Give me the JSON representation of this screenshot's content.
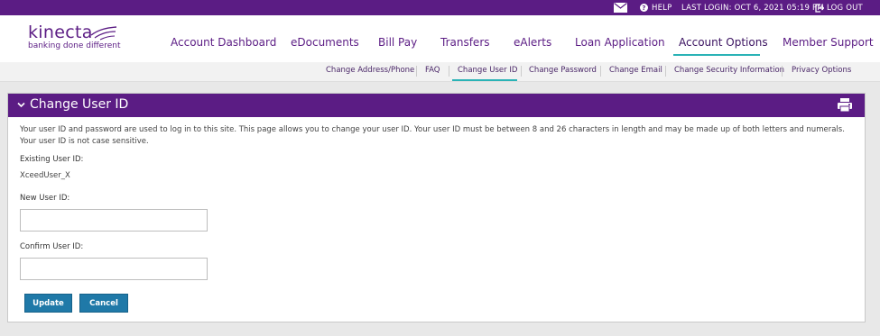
{
  "topbar": {
    "help_label": "HELP",
    "last_login": "LAST LOGIN: OCT 6, 2021 05:19 PM",
    "logout_label": "LOG OUT"
  },
  "brand": {
    "name": "kinecta",
    "tagline": "banking done different"
  },
  "nav": {
    "items": [
      {
        "label": "Account Dashboard"
      },
      {
        "label": "eDocuments"
      },
      {
        "label": "Bill Pay"
      },
      {
        "label": "Transfers"
      },
      {
        "label": "eAlerts"
      },
      {
        "label": "Loan Application"
      },
      {
        "label": "Account Options",
        "active": true
      },
      {
        "label": "Member Support"
      }
    ]
  },
  "subnav": {
    "items": [
      {
        "label": "Change Address/Phone"
      },
      {
        "label": "FAQ"
      },
      {
        "label": "Change User ID",
        "active": true
      },
      {
        "label": "Change Password"
      },
      {
        "label": "Change Email"
      },
      {
        "label": "Change Security Information"
      },
      {
        "label": "Privacy Options"
      }
    ]
  },
  "panel": {
    "title": "Change User ID",
    "intro": "Your user ID and password are used to log in to this site. This page allows you to change your user ID. Your user ID must be between 8 and 26 characters in length and may be made up of both letters and numerals. Your user ID is not case sensitive.",
    "existing_label": "Existing User ID:",
    "existing_value": "XceedUser_X",
    "new_label": "New User ID:",
    "new_value": "",
    "confirm_label": "Confirm User ID:",
    "confirm_value": "",
    "update_label": "Update",
    "cancel_label": "Cancel"
  },
  "colors": {
    "brand_purple": "#5b1c84",
    "accent_teal": "#2ab3b6",
    "button_blue": "#1f79a8"
  }
}
